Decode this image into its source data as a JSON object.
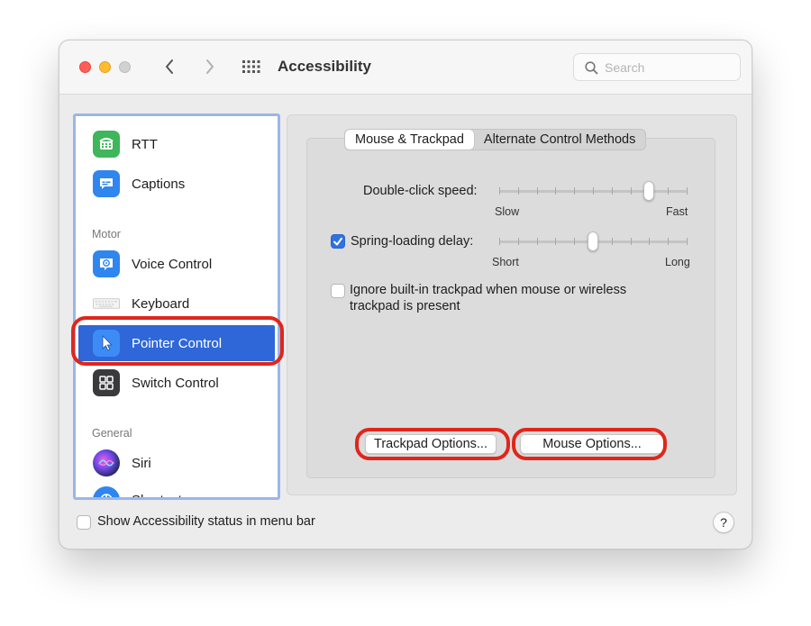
{
  "window": {
    "title": "Accessibility"
  },
  "search": {
    "placeholder": "Search"
  },
  "sidebar": {
    "items": [
      {
        "label": "RTT",
        "icon": "rtt-icon"
      },
      {
        "label": "Captions",
        "icon": "captions-icon"
      },
      {
        "label": "Voice Control",
        "icon": "voice-control-icon"
      },
      {
        "label": "Keyboard",
        "icon": "keyboard-icon"
      },
      {
        "label": "Pointer Control",
        "icon": "pointer-icon",
        "selected": true
      },
      {
        "label": "Switch Control",
        "icon": "switch-control-icon"
      },
      {
        "label": "Siri",
        "icon": "siri-icon"
      },
      {
        "label": "Shortcut",
        "icon": "shortcut-icon"
      }
    ],
    "sections": {
      "motor": "Motor",
      "general": "General"
    }
  },
  "tabs": [
    {
      "label": "Mouse & Trackpad",
      "active": true
    },
    {
      "label": "Alternate Control Methods",
      "active": false
    }
  ],
  "settings": {
    "double_click": {
      "label": "Double-click speed:",
      "min_label": "Slow",
      "max_label": "Fast",
      "value_fraction": 0.8
    },
    "spring_loading": {
      "label": "Spring-loading delay:",
      "checked": true,
      "min_label": "Short",
      "max_label": "Long",
      "value_fraction": 0.5
    },
    "ignore_trackpad": {
      "label_line1": "Ignore built-in trackpad when mouse or wireless",
      "label_line2": "trackpad is present",
      "checked": false
    }
  },
  "buttons": {
    "trackpad_options": "Trackpad Options...",
    "mouse_options": "Mouse Options..."
  },
  "footer": {
    "status_checkbox_label": "Show Accessibility status in menu bar",
    "status_checked": false,
    "help": "?"
  },
  "colors": {
    "accent": "#2f67d8",
    "highlight_ring": "#e0261b"
  }
}
